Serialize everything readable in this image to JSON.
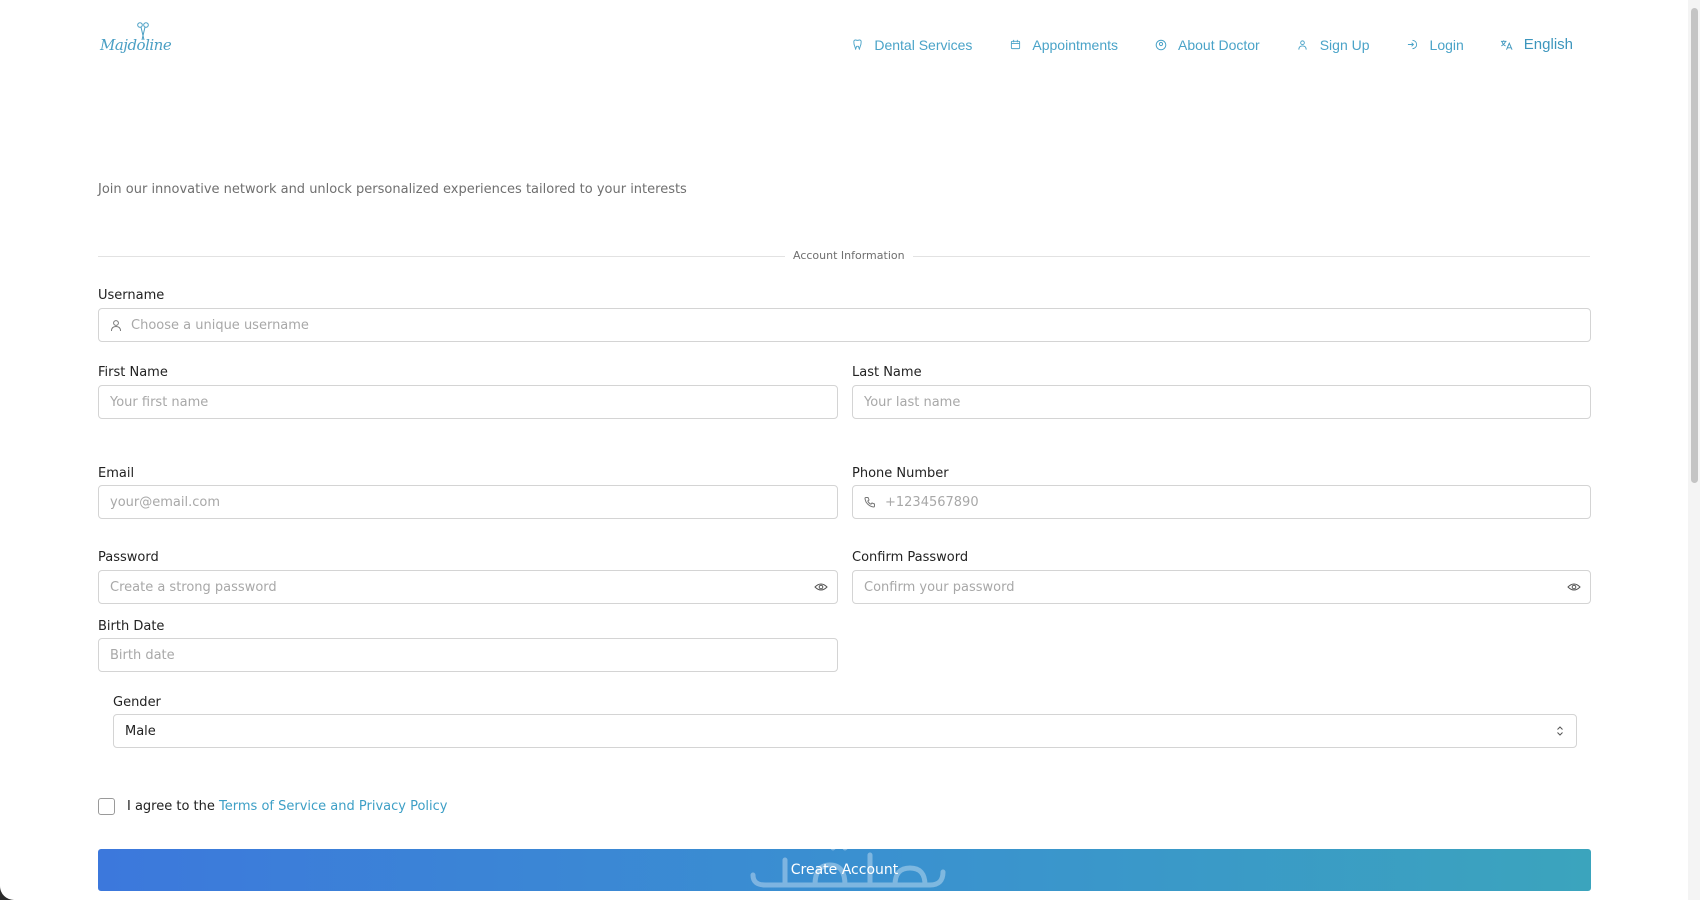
{
  "brand": {
    "logo_text": "Majdoline"
  },
  "nav": {
    "items": [
      {
        "label": "Dental Services",
        "icon": "tooth-icon"
      },
      {
        "label": "Appointments",
        "icon": "calendar-icon"
      },
      {
        "label": "About Doctor",
        "icon": "user-circle-icon"
      },
      {
        "label": "Sign Up",
        "icon": "user-plus-icon"
      },
      {
        "label": "Login",
        "icon": "login-icon"
      },
      {
        "label": "English",
        "icon": "translate-icon"
      }
    ]
  },
  "page": {
    "subtitle": "Join our innovative network and unlock personalized experiences tailored to your interests",
    "section_label": "Account Information"
  },
  "form": {
    "username": {
      "label": "Username",
      "placeholder": "Choose a unique username",
      "value": ""
    },
    "first_name": {
      "label": "First Name",
      "placeholder": "Your first name",
      "value": ""
    },
    "last_name": {
      "label": "Last Name",
      "placeholder": "Your last name",
      "value": ""
    },
    "email": {
      "label": "Email",
      "placeholder": "your@email.com",
      "value": ""
    },
    "phone": {
      "label": "Phone Number",
      "placeholder": "+1234567890",
      "value": ""
    },
    "password": {
      "label": "Password",
      "placeholder": "Create a strong password",
      "value": ""
    },
    "confirm_password": {
      "label": "Confirm Password",
      "placeholder": "Confirm your password",
      "value": ""
    },
    "birth_date": {
      "label": "Birth Date",
      "placeholder": "Birth date",
      "value": ""
    },
    "gender": {
      "label": "Gender",
      "value": "Male"
    },
    "terms": {
      "prefix": "I agree to the",
      "link": "Terms of Service and Privacy Policy",
      "checked": false
    },
    "submit_label": "Create Account"
  },
  "colors": {
    "accent": "#4aa3c8",
    "button_gradient_start": "#3c78dc",
    "button_gradient_end": "#3ba4bd"
  }
}
